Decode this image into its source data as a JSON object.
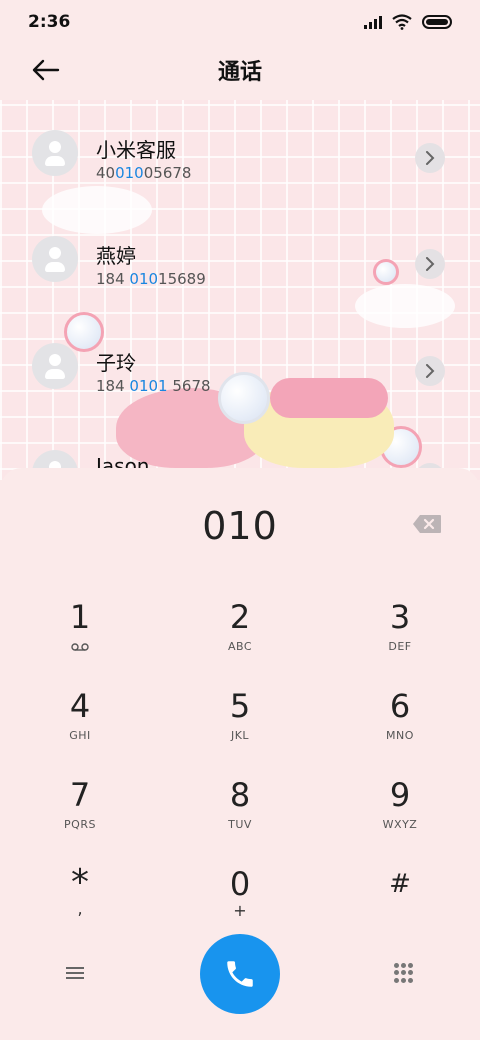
{
  "status": {
    "time": "2:36"
  },
  "header": {
    "title": "通话"
  },
  "contacts": [
    {
      "name": "小米客服",
      "num_pre": "40",
      "num_hl": "010",
      "num_post": "05678"
    },
    {
      "name": "燕婷",
      "num_pre": "184 ",
      "num_hl": "010",
      "num_post": "15689"
    },
    {
      "name": "子玲",
      "num_pre": "184 ",
      "num_hl": "0101",
      "num_post": " 5678"
    },
    {
      "name": "Jason",
      "num_pre": "",
      "num_hl": "",
      "num_post": ""
    }
  ],
  "dialer": {
    "input": "010",
    "keys": [
      {
        "digit": "1",
        "sub": ""
      },
      {
        "digit": "2",
        "sub": "ABC"
      },
      {
        "digit": "3",
        "sub": "DEF"
      },
      {
        "digit": "4",
        "sub": "GHI"
      },
      {
        "digit": "5",
        "sub": "JKL"
      },
      {
        "digit": "6",
        "sub": "MNO"
      },
      {
        "digit": "7",
        "sub": "PQRS"
      },
      {
        "digit": "8",
        "sub": "TUV"
      },
      {
        "digit": "9",
        "sub": "WXYZ"
      },
      {
        "digit": "*",
        "sub": ","
      },
      {
        "digit": "0",
        "sub": "+"
      },
      {
        "digit": "#",
        "sub": ""
      }
    ]
  },
  "colors": {
    "accent": "#1894ee",
    "highlight": "#1a86e0"
  },
  "icons": {
    "back": "arrow-left-icon",
    "voicemail": "voicemail-icon",
    "backspace": "backspace-icon",
    "menu": "menu-icon",
    "call": "phone-icon",
    "keypad": "keypad-icon"
  }
}
